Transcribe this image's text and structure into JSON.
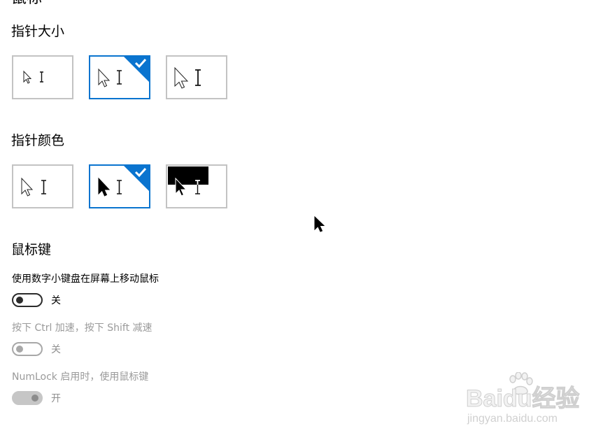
{
  "page": {
    "heading": "鼠标"
  },
  "pointer_size": {
    "title": "指针大小",
    "options": [
      {
        "name": "small",
        "selected": false
      },
      {
        "name": "medium",
        "selected": true
      },
      {
        "name": "large",
        "selected": false
      }
    ]
  },
  "pointer_color": {
    "title": "指针颜色",
    "options": [
      {
        "name": "white",
        "selected": false
      },
      {
        "name": "black",
        "selected": true
      },
      {
        "name": "inverted",
        "selected": false
      }
    ]
  },
  "mouse_keys": {
    "title": "鼠标键",
    "setting1": {
      "label": "使用数字小键盘在屏幕上移动鼠标",
      "state": "关"
    },
    "setting2": {
      "label": "按下 Ctrl 加速，按下 Shift 减速",
      "state": "关"
    },
    "setting3": {
      "label": "NumLock 启用时，使用鼠标键",
      "state": "开"
    }
  },
  "colors": {
    "accent": "#0a74cf",
    "tile_border": "#c3c3c3",
    "disabled_text": "#9a9a9a"
  },
  "watermark": {
    "brand": "Baidu经验",
    "url": "jingyan.baidu.com"
  }
}
